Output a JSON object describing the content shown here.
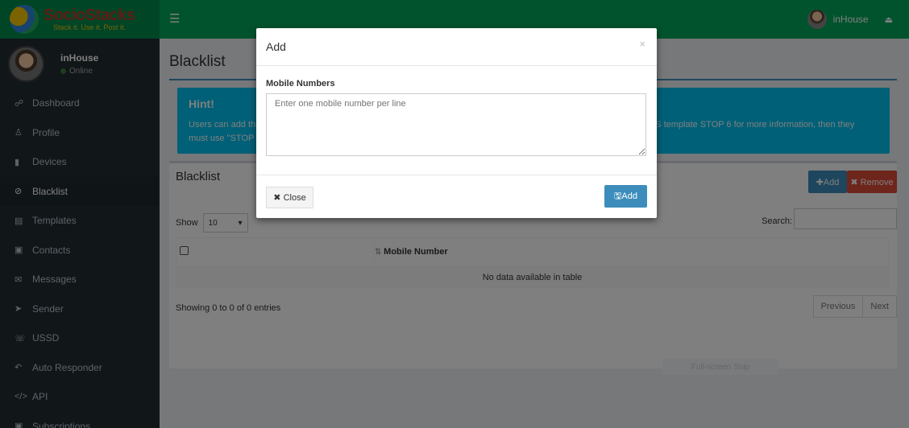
{
  "header": {
    "logo_name": "SocioStacks",
    "logo_tagline": "Stack it. Use it. Post it.",
    "menu_icon": "☰",
    "user_name": "inHouse",
    "signout_icon": "⏏"
  },
  "sidebar": {
    "user_name": "inHouse",
    "user_status": "Online",
    "items": [
      {
        "icon": "☍",
        "label": "Dashboard"
      },
      {
        "icon": "♙",
        "label": "Profile"
      },
      {
        "icon": "▮",
        "label": "Devices"
      },
      {
        "icon": "⊘",
        "label": "Blacklist"
      },
      {
        "icon": "▤",
        "label": "Templates"
      },
      {
        "icon": "▣",
        "label": "Contacts"
      },
      {
        "icon": "✉",
        "label": "Messages"
      },
      {
        "icon": "➤",
        "label": "Sender"
      },
      {
        "icon": "☏",
        "label": "USSD"
      },
      {
        "icon": "↶",
        "label": "Auto Responder"
      },
      {
        "icon": "</>",
        "label": "API"
      },
      {
        "icon": "▣",
        "label": "Subscriptions"
      }
    ],
    "active_index": 3
  },
  "page": {
    "title": "Blacklist"
  },
  "hint": {
    "title": "Hint!",
    "text": "Users can add their number to the blacklist by replying STOP to your messages. If the message was sent using the SMS template STOP 6 for more information, then they must use \"STOP 6\" instead of \"STOP\" to add their number to the blacklist."
  },
  "box": {
    "title": "Blacklist",
    "add_label": "✚Add",
    "remove_label": "✖ Remove",
    "show_label": "Show",
    "show_value": "10",
    "search_label": "Search:",
    "columns": [
      "",
      "Mobile Number"
    ],
    "empty_text": "No data available in table",
    "showing_text": "Showing 0 to 0 of 0 entries",
    "prev_label": "Previous",
    "next_label": "Next"
  },
  "fullscreen_label": "Full-screen Snip",
  "modal": {
    "title": "Add",
    "close_x": "×",
    "field_label": "Mobile Numbers",
    "placeholder": "Enter one mobile number per line",
    "close_label": "✖ Close",
    "add_label": "🖫Add"
  }
}
